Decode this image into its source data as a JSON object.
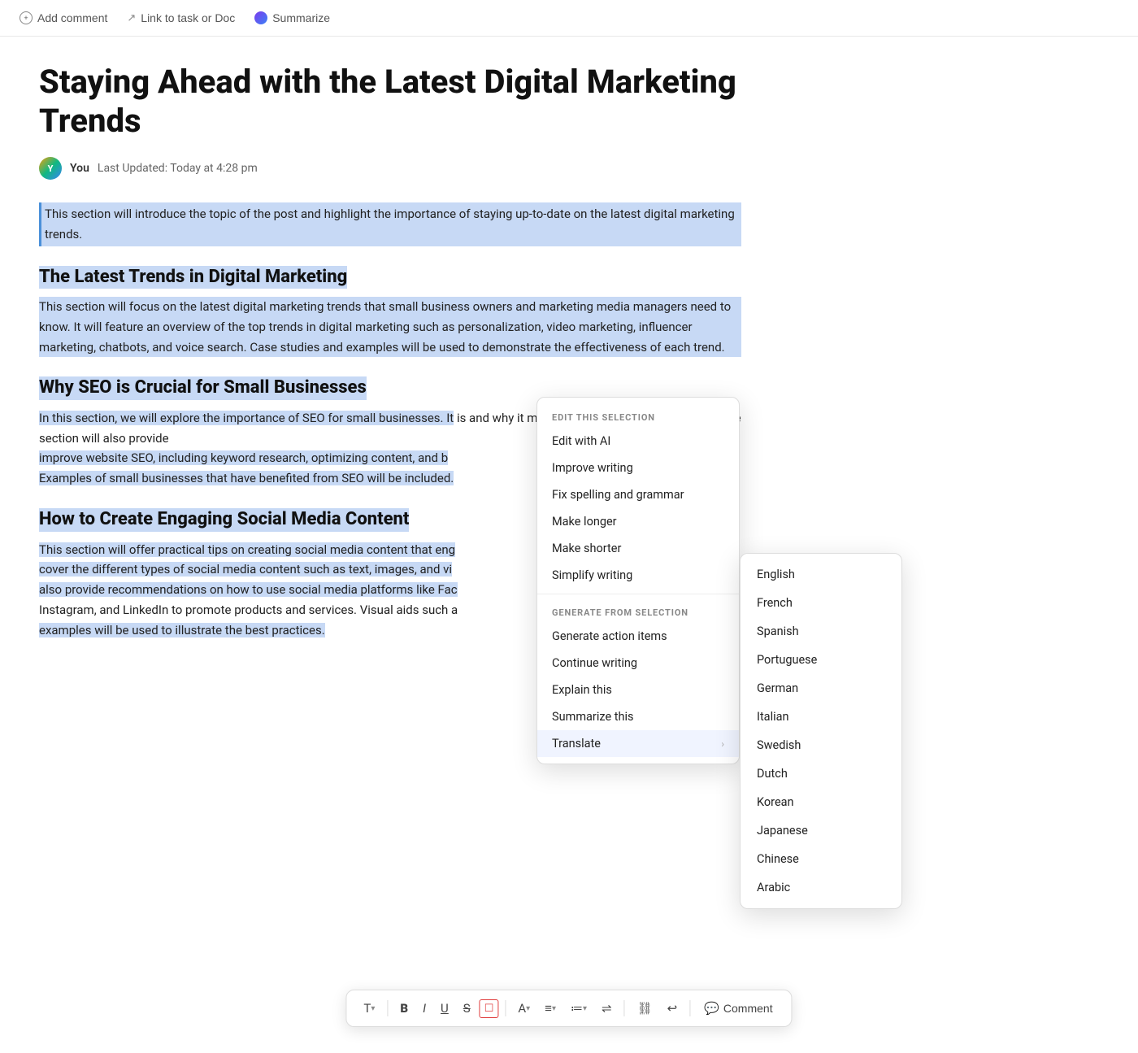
{
  "toolbar": {
    "add_comment": "Add comment",
    "link_task": "Link to task or Doc",
    "summarize": "Summarize"
  },
  "doc": {
    "title": "Staying Ahead with the Latest Digital Marketing Trends",
    "meta": {
      "user": "You",
      "updated_label": "Last Updated: Today at 4:28 pm"
    },
    "sections": [
      {
        "id": "intro",
        "heading": null,
        "body": "This section will introduce the topic of the post and highlight the importance of staying up-to-date on the latest digital marketing trends.",
        "selected": true
      },
      {
        "id": "latest-trends",
        "heading": "The Latest Trends in Digital Marketing",
        "body": "This section will focus on the latest digital marketing trends that small business owners and marketing media managers need to know. It will feature an overview of the top trends in digital marketing such as personalization, video marketing, influencer marketing, chatbots, and voice search. Case studies and examples will be used to demonstrate the effectiveness of each trend.",
        "selected": true
      },
      {
        "id": "seo",
        "heading": "Why SEO is Crucial for Small Businesses",
        "body": "In this section, we will explore the importance of SEO for small businesses. It is and why it matters for small business owners. The section will also provide improve website SEO, including keyword research, optimizing content, and b Examples of small businesses that have benefited from SEO will be included.",
        "selected": true,
        "partial": true
      },
      {
        "id": "social",
        "heading": "How to Create Engaging Social Media Content",
        "body": "This section will offer practical tips on creating social media content that eng cover the different types of social media content such as text, images, and vi also provide recommendations on how to use social media platforms like Fac Instagram, and LinkedIn to promote products and services. Visual aids such a examples will be used to illustrate the best practices.",
        "selected": true,
        "partial": true
      }
    ]
  },
  "context_menu": {
    "edit_section_label": "EDIT THIS SELECTION",
    "items_edit": [
      {
        "label": "Edit with AI",
        "has_arrow": false
      },
      {
        "label": "Improve writing",
        "has_arrow": false
      },
      {
        "label": "Fix spelling and grammar",
        "has_arrow": false
      },
      {
        "label": "Make longer",
        "has_arrow": false
      },
      {
        "label": "Make shorter",
        "has_arrow": false
      },
      {
        "label": "Simplify writing",
        "has_arrow": false
      }
    ],
    "generate_section_label": "GENERATE FROM SELECTION",
    "items_generate": [
      {
        "label": "Generate action items",
        "has_arrow": false
      },
      {
        "label": "Continue writing",
        "has_arrow": false
      },
      {
        "label": "Explain this",
        "has_arrow": false
      },
      {
        "label": "Summarize this",
        "has_arrow": false
      },
      {
        "label": "Translate",
        "has_arrow": true,
        "active": true
      }
    ]
  },
  "translate_submenu": {
    "languages": [
      {
        "label": "English"
      },
      {
        "label": "French"
      },
      {
        "label": "Spanish"
      },
      {
        "label": "Portuguese"
      },
      {
        "label": "German"
      },
      {
        "label": "Italian"
      },
      {
        "label": "Swedish"
      },
      {
        "label": "Dutch"
      },
      {
        "label": "Korean"
      },
      {
        "label": "Japanese"
      },
      {
        "label": "Chinese"
      },
      {
        "label": "Arabic"
      }
    ]
  },
  "format_toolbar": {
    "buttons": [
      {
        "label": "T",
        "type": "text-style",
        "has_arrow": true
      },
      {
        "label": "B",
        "type": "bold"
      },
      {
        "label": "I",
        "type": "italic"
      },
      {
        "label": "U",
        "type": "underline"
      },
      {
        "label": "S",
        "type": "strikethrough"
      },
      {
        "label": "☐",
        "type": "checkbox"
      },
      {
        "label": "A",
        "type": "color",
        "has_arrow": true
      },
      {
        "label": "≡",
        "type": "align",
        "has_arrow": true
      },
      {
        "label": "≔",
        "type": "list",
        "has_arrow": true
      },
      {
        "label": "⇌",
        "type": "indent"
      },
      {
        "label": "⛓",
        "type": "link"
      },
      {
        "label": "↩",
        "type": "undo"
      }
    ],
    "comment_label": "Comment"
  }
}
